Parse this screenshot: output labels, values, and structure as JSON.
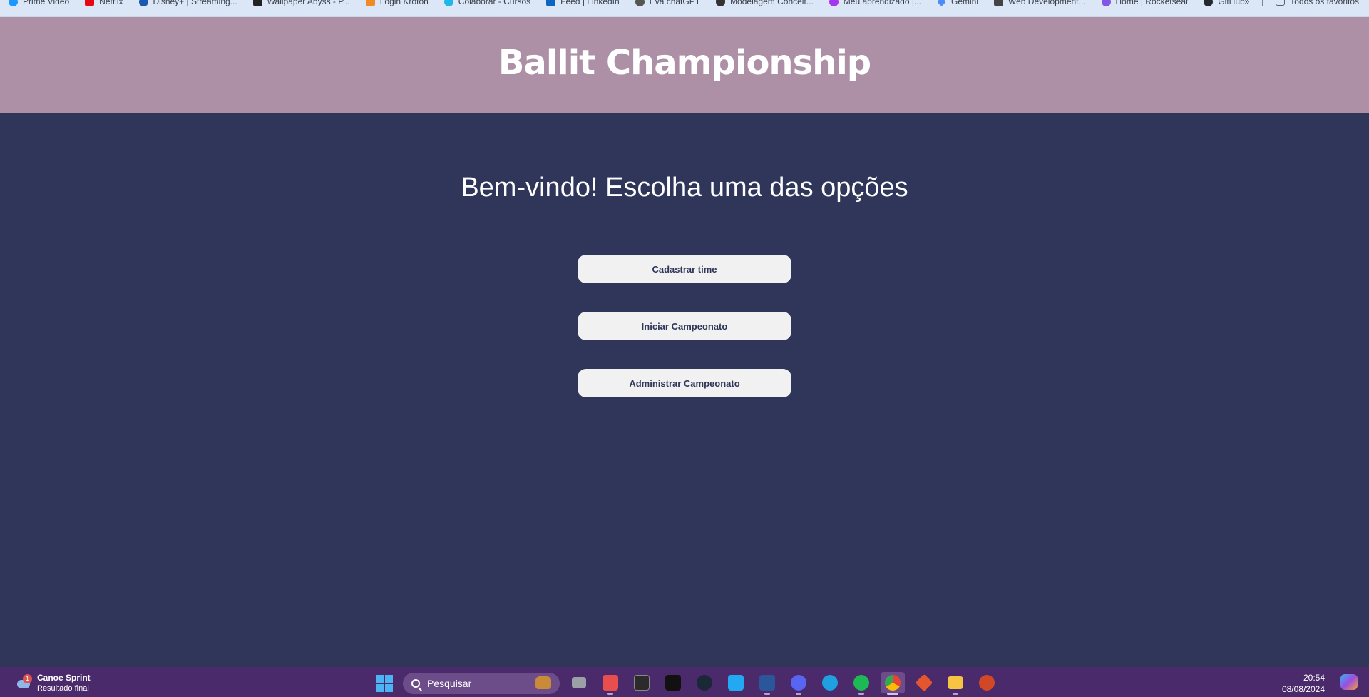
{
  "bookmarks": {
    "items": [
      {
        "label": "Prime Video",
        "icon": "prime-video-icon",
        "color": "#1a98ff"
      },
      {
        "label": "Netflix",
        "icon": "netflix-icon",
        "color": "#e50914"
      },
      {
        "label": "Disney+ | Streaming...",
        "icon": "disney-plus-icon",
        "color": "#1d58b0"
      },
      {
        "label": "Wallpaper Abyss - P...",
        "icon": "wallpaper-abyss-icon",
        "color": "#222222"
      },
      {
        "label": "Login Kroton",
        "icon": "kroton-icon",
        "color": "#f08a24"
      },
      {
        "label": "Colaborar - Cursos",
        "icon": "colaborar-icon",
        "color": "#1fb6e8"
      },
      {
        "label": "Feed | LinkedIn",
        "icon": "linkedin-icon",
        "color": "#0a66c2"
      },
      {
        "label": "Eva chatGPT",
        "icon": "chatgpt-icon",
        "color": "#555555"
      },
      {
        "label": "Modelagem Conceit...",
        "icon": "shield-icon",
        "color": "#333333"
      },
      {
        "label": "Meu aprendizado |...",
        "icon": "udemy-icon",
        "color": "#a435f0"
      },
      {
        "label": "Gemini",
        "icon": "gemini-icon",
        "color": "#4b8df8"
      },
      {
        "label": "Web Development...",
        "icon": "document-icon",
        "color": "#444444"
      },
      {
        "label": "Home | Rocketseat",
        "icon": "rocketseat-icon",
        "color": "#8257e5"
      },
      {
        "label": "GitHub",
        "icon": "github-icon",
        "color": "#24292f"
      }
    ],
    "overflow": "»",
    "all_favorites": "Todos os favoritos"
  },
  "header": {
    "title": "Ballit Championship",
    "background": "#ad90a5"
  },
  "main": {
    "welcome": "Bem-vindo! Escolha uma das opções",
    "background": "#2f3659",
    "buttons": {
      "register_team": "Cadastrar time",
      "start_championship": "Iniciar Campeonato",
      "manage_championship": "Administrar Campeonato"
    }
  },
  "taskbar": {
    "weather_title": "Canoe Sprint",
    "weather_subtitle": "Resultado final",
    "weather_badge": "1",
    "search_placeholder": "Pesquisar",
    "apps": [
      {
        "name": "task-view-icon",
        "color": "#9aa0a6"
      },
      {
        "name": "snipping-tool-icon",
        "color": "#e94e4e"
      },
      {
        "name": "terminal-icon",
        "color": "#2b2b2b"
      },
      {
        "name": "epic-games-icon",
        "color": "#111111"
      },
      {
        "name": "steam-icon",
        "color": "#1b2838"
      },
      {
        "name": "vscode-icon",
        "color": "#23a9f2"
      },
      {
        "name": "word-icon",
        "color": "#2b579a"
      },
      {
        "name": "discord-icon",
        "color": "#5865f2"
      },
      {
        "name": "edge-icon",
        "color": "#1fa0e0"
      },
      {
        "name": "spotify-icon",
        "color": "#1db954"
      },
      {
        "name": "chrome-icon",
        "color": "#f2c230"
      },
      {
        "name": "git-icon",
        "color": "#e4572e"
      },
      {
        "name": "file-explorer-icon",
        "color": "#f6c343"
      },
      {
        "name": "powerpoint-icon",
        "color": "#d24726"
      }
    ],
    "time": "20:54",
    "date": "08/08/2024"
  }
}
